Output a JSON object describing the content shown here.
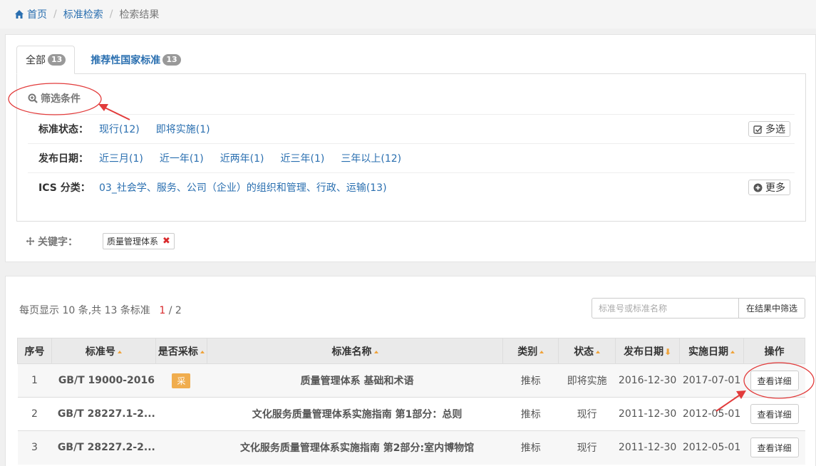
{
  "breadcrumb": {
    "home": "首页",
    "search": "标准检索",
    "current": "检索结果"
  },
  "tabs": [
    {
      "label": "全部",
      "count": "13"
    },
    {
      "label": "推荐性国家标准",
      "count": "13"
    }
  ],
  "filter": {
    "title": "筛选条件",
    "rows": [
      {
        "label": "标准状态：",
        "options": [
          "现行(12)",
          "即将实施(1)"
        ],
        "action": "多选"
      },
      {
        "label": "发布日期：",
        "options": [
          "近三月(1)",
          "近一年(1)",
          "近两年(1)",
          "近三年(1)",
          "三年以上(12)"
        ]
      },
      {
        "label": "ICS 分类：",
        "options": [
          "03_社会学、服务、公司（企业）的组织和管理、行政、运输(13)"
        ],
        "action": "更多"
      }
    ],
    "keyword_label": "关键字：",
    "keyword_tag": "质量管理体系",
    "keyword_remove": "✖"
  },
  "results": {
    "summary_prefix": "每页显示 10 条,共 13 条标准",
    "current_page": "1",
    "total_pages": "/ 2",
    "search_placeholder": "标准号或标准名称",
    "search_button": "在结果中筛选",
    "columns": [
      "序号",
      "标准号",
      "是否采标",
      "标准名称",
      "类别",
      "状态",
      "发布日期",
      "实施日期",
      "操作"
    ],
    "rows": [
      {
        "no": "1",
        "code": "GB/T 19000-2016",
        "adopt": "采",
        "name": "质量管理体系 基础和术语",
        "type": "推标",
        "status": "即将实施",
        "publish": "2016-12-30",
        "effective": "2017-07-01",
        "action": "查看详细"
      },
      {
        "no": "2",
        "code": "GB/T 28227.1-2...",
        "adopt": "",
        "name": "文化服务质量管理体系实施指南 第1部分：总则",
        "type": "推标",
        "status": "现行",
        "publish": "2011-12-30",
        "effective": "2012-05-01",
        "action": "查看详细"
      },
      {
        "no": "3",
        "code": "GB/T 28227.2-2...",
        "adopt": "",
        "name": "文化服务质量管理体系实施指南 第2部分:室内博物馆",
        "type": "推标",
        "status": "现行",
        "publish": "2011-12-30",
        "effective": "2012-05-01",
        "action": "查看详细"
      }
    ]
  },
  "colors": {
    "link": "#2a6fb0",
    "accent": "#f0ad4e",
    "annotation": "#e23b3b",
    "remove": "#d9292b"
  }
}
